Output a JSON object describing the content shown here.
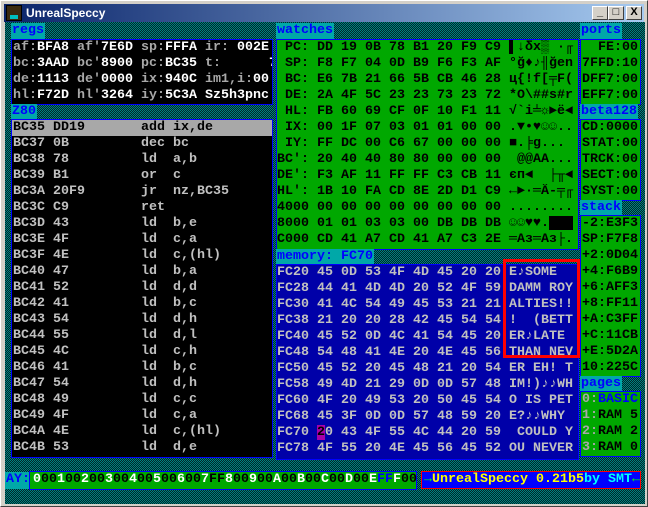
{
  "window": {
    "title": "UnrealSpeccy",
    "minimize": "_",
    "maximize": "□",
    "close": "X"
  },
  "regs": {
    "label": "regs",
    "rows": [
      [
        [
          "af:",
          "BFA8"
        ],
        [
          "af'",
          "7E6D"
        ],
        [
          "sp:",
          "FFFA"
        ],
        [
          "ir:",
          " 002E"
        ]
      ],
      [
        [
          "bc:",
          "3AAD"
        ],
        [
          "bc'",
          "8900"
        ],
        [
          "pc:",
          "BC35"
        ],
        [
          "t:",
          "      7"
        ]
      ],
      [
        [
          "de:",
          "1113"
        ],
        [
          "de'",
          "0000"
        ],
        [
          "ix:",
          "940C"
        ],
        [
          "im1,i:",
          "00"
        ]
      ],
      [
        [
          "hl:",
          "F72D"
        ],
        [
          "hl'",
          "3264"
        ],
        [
          "iy:",
          "5C3A"
        ],
        [
          "",
          "Sz5h3pnc"
        ]
      ]
    ]
  },
  "disasm": {
    "label": "Z80",
    "selected": 0,
    "rows": [
      [
        "BC35",
        "DD19",
        "add",
        "ix,de"
      ],
      [
        "BC37",
        "0B",
        "dec",
        "bc"
      ],
      [
        "BC38",
        "78",
        "ld",
        "a,b"
      ],
      [
        "BC39",
        "B1",
        "or",
        "c"
      ],
      [
        "BC3A",
        "20F9",
        "jr",
        "nz,BC35"
      ],
      [
        "BC3C",
        "C9",
        "ret",
        ""
      ],
      [
        "BC3D",
        "43",
        "ld",
        "b,e"
      ],
      [
        "BC3E",
        "4F",
        "ld",
        "c,a"
      ],
      [
        "BC3F",
        "4E",
        "ld",
        "c,(hl)"
      ],
      [
        "BC40",
        "47",
        "ld",
        "b,a"
      ],
      [
        "BC41",
        "52",
        "ld",
        "d,d"
      ],
      [
        "BC42",
        "41",
        "ld",
        "b,c"
      ],
      [
        "BC43",
        "54",
        "ld",
        "d,h"
      ],
      [
        "BC44",
        "55",
        "ld",
        "d,l"
      ],
      [
        "BC45",
        "4C",
        "ld",
        "c,h"
      ],
      [
        "BC46",
        "41",
        "ld",
        "b,c"
      ],
      [
        "BC47",
        "54",
        "ld",
        "d,h"
      ],
      [
        "BC48",
        "49",
        "ld",
        "c,c"
      ],
      [
        "BC49",
        "4F",
        "ld",
        "c,a"
      ],
      [
        "BC4A",
        "4E",
        "ld",
        "c,(hl)"
      ],
      [
        "BC4B",
        "53",
        "ld",
        "d,e"
      ]
    ]
  },
  "watches": {
    "label": "watches",
    "rows": [
      [
        " PC:",
        "DD 19 0B 78 B1 20 F9 C9",
        "▌↓δx▒ ·╓"
      ],
      [
        " SP:",
        "F8 F7 04 0D B9 F6 F3 AF",
        "°ğ♦♪╢ğen"
      ],
      [
        " BC:",
        "E6 7B 21 66 5B CB 46 28",
        "ц{!f[╤F("
      ],
      [
        " DE:",
        "2A 4F 5C 23 23 73 23 72",
        "*O\\##s#r"
      ],
      [
        " HL:",
        "FB 60 69 CF 0F 10 F1 11",
        "√`i╧☼►ë◄"
      ],
      [
        " IX:",
        "00 1F 07 03 01 01 00 00",
        ".▼•♥☺☺.."
      ],
      [
        " IY:",
        "FF DC 00 C6 67 00 00 00",
        "■.╞g..."
      ],
      [
        "BC':",
        "20 40 40 80 80 00 00 00",
        " @@AA..."
      ],
      [
        "DE':",
        "F3 AF 11 FF FF C3 CB 11",
        "єп◄  ├╥◄"
      ],
      [
        "HL':",
        "1B 10 FA CD 8E 2D D1 C9",
        "←►·═Ä-╤╓"
      ],
      [
        "4000",
        "00 00 00 00 00 00 00 00",
        "........"
      ],
      [
        "8000",
        "01 01 03 03 00 DB DB DB",
        "☺☺♥♥.███"
      ],
      [
        "C000",
        "CD 41 A7 CD 41 A7 C3 2E",
        "═Aз═Aз├."
      ]
    ]
  },
  "memory": {
    "label": "memory: FC70",
    "rows": [
      [
        "FC20",
        "45 0D 53 4F 4D 45 20 20",
        "E♪SOME  "
      ],
      [
        "FC28",
        "44 41 4D 4D 20 52 4F 59",
        "DAMM ROY"
      ],
      [
        "FC30",
        "41 4C 54 49 45 53 21 21",
        "ALTIES!!"
      ],
      [
        "FC38",
        "21 20 20 28 42 45 54 54",
        "!  (BETT"
      ],
      [
        "FC40",
        "45 52 0D 4C 41 54 45 20",
        "ER♪LATE "
      ],
      [
        "FC48",
        "54 48 41 4E 20 4E 45 56",
        "THAN NEV"
      ],
      [
        "FC50",
        "45 52 20 45 48 21 20 54",
        "ER EH! T"
      ],
      [
        "FC58",
        "49 4D 21 29 0D 0D 57 48",
        "IM!)♪♪WH"
      ],
      [
        "FC60",
        "4F 20 49 53 20 50 45 54",
        "O IS PET"
      ],
      [
        "FC68",
        "45 3F 0D 0D 57 48 59 20",
        "E?♪♪WHY "
      ],
      [
        "FC70",
        "20 43 4F 55 4C 44 20 59",
        " COULD Y"
      ],
      [
        "FC78",
        "4F 55 20 4E 45 56 45 52",
        "OU NEVER"
      ]
    ],
    "cursor_row": 10
  },
  "ports": {
    "label": "ports",
    "rows": [
      "  FE:00",
      "7FFD:10",
      "DFF7:00",
      "EFF7:00"
    ]
  },
  "beta128": {
    "label": "beta128",
    "rows": [
      "CD:0000",
      "STAT:00",
      "TRCK:00",
      "SECT:00",
      "SYST:00"
    ]
  },
  "stack": {
    "label": "stack",
    "rows": [
      "-2:E3F3",
      "SP:F7F8",
      "+2:0D04",
      "+4:F6B9",
      "+6:AFF3",
      "+8:FF11",
      "+A:C3FF",
      "+C:11CB",
      "+E:5D2A",
      "10:225C"
    ]
  },
  "pages": {
    "label": "pages",
    "rows": [
      [
        "0:",
        "BASIC"
      ],
      [
        "1:",
        "RAM 5"
      ],
      [
        "2:",
        "RAM 2"
      ],
      [
        "3:",
        "RAM 0"
      ]
    ]
  },
  "ay": {
    "label": "AY:",
    "regs": [
      [
        "0",
        "00"
      ],
      [
        "1",
        "00"
      ],
      [
        "2",
        "00"
      ],
      [
        "3",
        "00"
      ],
      [
        "4",
        "00"
      ],
      [
        "5",
        "00"
      ],
      [
        "6",
        "00"
      ],
      [
        "7",
        "FF"
      ],
      [
        "8",
        "00"
      ],
      [
        "9",
        "00"
      ],
      [
        "A",
        "00"
      ],
      [
        "B",
        "00"
      ],
      [
        "C",
        "00"
      ],
      [
        "D",
        "00"
      ],
      [
        "E",
        "FF"
      ],
      [
        "F",
        "00"
      ]
    ],
    "highlight_reg": "E"
  },
  "version": {
    "arrow_l": "→",
    "name": "UnrealSpeccy 0.21b5",
    "by": "by SMT",
    "arrow_r": "←"
  }
}
